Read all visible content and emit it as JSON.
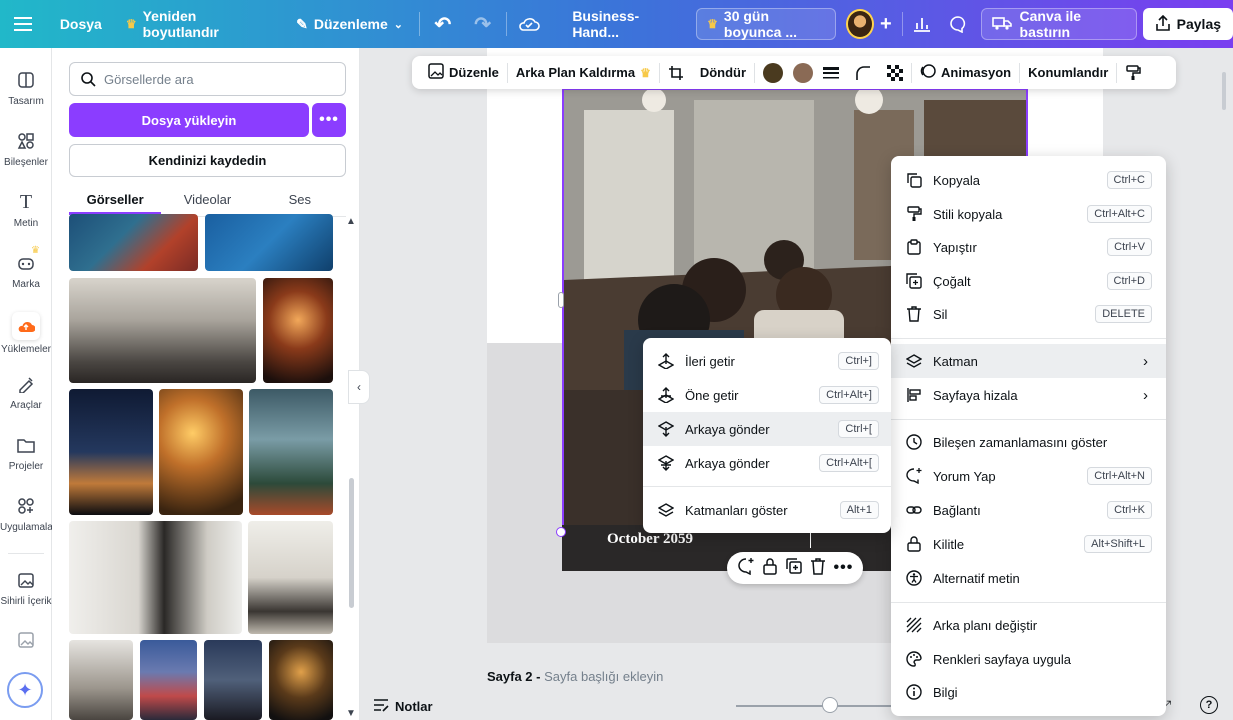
{
  "topbar": {
    "file": "Dosya",
    "resize": "Yeniden boyutlandır",
    "edit": "Düzenleme",
    "doc_title": "Business-Hand...",
    "trial": "30 gün boyunca ...",
    "print": "Canva ile bastırın",
    "share": "Paylaş"
  },
  "leftnav": [
    {
      "label": "Tasarım",
      "icon": "design-icon"
    },
    {
      "label": "Bileşenler",
      "icon": "elements-icon"
    },
    {
      "label": "Metin",
      "icon": "text-icon"
    },
    {
      "label": "Marka",
      "icon": "brand-icon"
    },
    {
      "label": "Yüklemeler",
      "icon": "uploads-icon"
    },
    {
      "label": "Araçlar",
      "icon": "tools-icon"
    },
    {
      "label": "Projeler",
      "icon": "projects-icon"
    },
    {
      "label": "Uygulamalar",
      "icon": "apps-icon"
    },
    {
      "label": "Sihirli İçerik",
      "icon": "magic-media-icon"
    }
  ],
  "panel": {
    "search_placeholder": "Görsellerde ara",
    "upload": "Dosya yükleyin",
    "record": "Kendinizi kaydedin",
    "tabs": [
      "Görseller",
      "Videolar",
      "Ses"
    ]
  },
  "element_toolbar": {
    "edit": "Düzenle",
    "bg_remove": "Arka Plan Kaldırma",
    "rotate": "Döndür",
    "animate": "Animasyon",
    "position": "Konumlandır",
    "swatch1": "#4a3a1f",
    "swatch2": "#8a6a55"
  },
  "canvas": {
    "date_text": "October 2059",
    "page_label_bold": "Sayfa 2 -",
    "page_label_hint": "Sayfa başlığı ekleyin"
  },
  "bottombar": {
    "notes": "Notlar"
  },
  "context_menu": [
    {
      "label": "Kopyala",
      "shortcut": "Ctrl+C",
      "icon": "copy-icon"
    },
    {
      "label": "Stili kopyala",
      "shortcut": "Ctrl+Alt+C",
      "icon": "paint-roller-icon"
    },
    {
      "label": "Yapıştır",
      "shortcut": "Ctrl+V",
      "icon": "clipboard-icon"
    },
    {
      "label": "Çoğalt",
      "shortcut": "Ctrl+D",
      "icon": "duplicate-icon"
    },
    {
      "label": "Sil",
      "shortcut": "DELETE",
      "icon": "trash-icon"
    },
    {
      "label": "Katman",
      "shortcut": "",
      "icon": "layers-icon"
    },
    {
      "label": "Sayfaya hizala",
      "shortcut": "",
      "icon": "align-icon"
    },
    {
      "label": "Bileşen zamanlamasını göster",
      "shortcut": "",
      "icon": "clock-icon"
    },
    {
      "label": "Yorum Yap",
      "shortcut": "Ctrl+Alt+N",
      "icon": "comment-icon"
    },
    {
      "label": "Bağlantı",
      "shortcut": "Ctrl+K",
      "icon": "link-icon"
    },
    {
      "label": "Kilitle",
      "shortcut": "Alt+Shift+L",
      "icon": "lock-icon"
    },
    {
      "label": "Alternatif metin",
      "shortcut": "",
      "icon": "accessibility-icon"
    },
    {
      "label": "Arka planı değiştir",
      "shortcut": "",
      "icon": "background-icon"
    },
    {
      "label": "Renkleri sayfaya uygula",
      "shortcut": "",
      "icon": "palette-icon"
    },
    {
      "label": "Bilgi",
      "shortcut": "",
      "icon": "info-icon"
    }
  ],
  "layer_submenu": [
    {
      "label": "İleri getir",
      "shortcut": "Ctrl+]"
    },
    {
      "label": "Öne getir",
      "shortcut": "Ctrl+Alt+]"
    },
    {
      "label": "Arkaya gönder",
      "shortcut": "Ctrl+["
    },
    {
      "label": "Arkaya gönder",
      "shortcut": "Ctrl+Alt+["
    },
    {
      "label": "Katmanları göster",
      "shortcut": "Alt+1"
    }
  ]
}
